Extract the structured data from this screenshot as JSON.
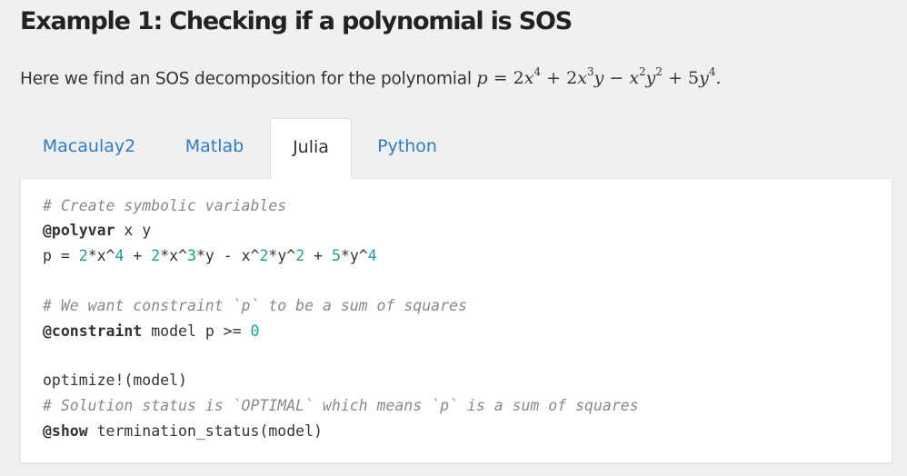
{
  "header": {
    "title": "Example 1: Checking if a polynomial is SOS"
  },
  "intro": {
    "text": "Here we find an SOS decomposition for the polynomial ",
    "p": "p",
    "eq": " = 2",
    "x1": "x",
    "e1": "4",
    "plus1": " + 2",
    "x2": "x",
    "e2": "3",
    "y2": "y",
    "minus": " − ",
    "x3": "x",
    "e3a": "2",
    "y3": "y",
    "e3b": "2",
    "plus2": " + 5",
    "y4": "y",
    "e4": "4",
    "end": "."
  },
  "tabs": [
    {
      "label": "Macaulay2",
      "active": false
    },
    {
      "label": "Matlab",
      "active": false
    },
    {
      "label": "Julia",
      "active": true
    },
    {
      "label": "Python",
      "active": false
    }
  ],
  "code": {
    "l1_comment": "# Create symbolic variables",
    "l2_macro": "@polyvar",
    "l2_rest": " x y",
    "l3_a": "p = ",
    "l3_n1": "2",
    "l3_b": "*x^",
    "l3_n2": "4",
    "l3_c": " + ",
    "l3_n3": "2",
    "l3_d": "*x^",
    "l3_n4": "3",
    "l3_e": "*y - x^",
    "l3_n5": "2",
    "l3_f": "*y^",
    "l3_n6": "2",
    "l3_g": " + ",
    "l3_n7": "5",
    "l3_h": "*y^",
    "l3_n8": "4",
    "l5_comment": "# We want constraint `p` to be a sum of squares",
    "l6_macro": "@constraint",
    "l6_rest": " model p >= ",
    "l6_num": "0",
    "l8": "optimize!(model)",
    "l9_comment": "# Solution status is `OPTIMAL` which means `p` is a sum of squares",
    "l10_macro": "@show",
    "l10_rest": " termination_status(model)"
  },
  "colors": {
    "link": "#2a7dc9",
    "comment": "#888888",
    "number": "#13a0a0",
    "background": "#f0f0f0"
  }
}
